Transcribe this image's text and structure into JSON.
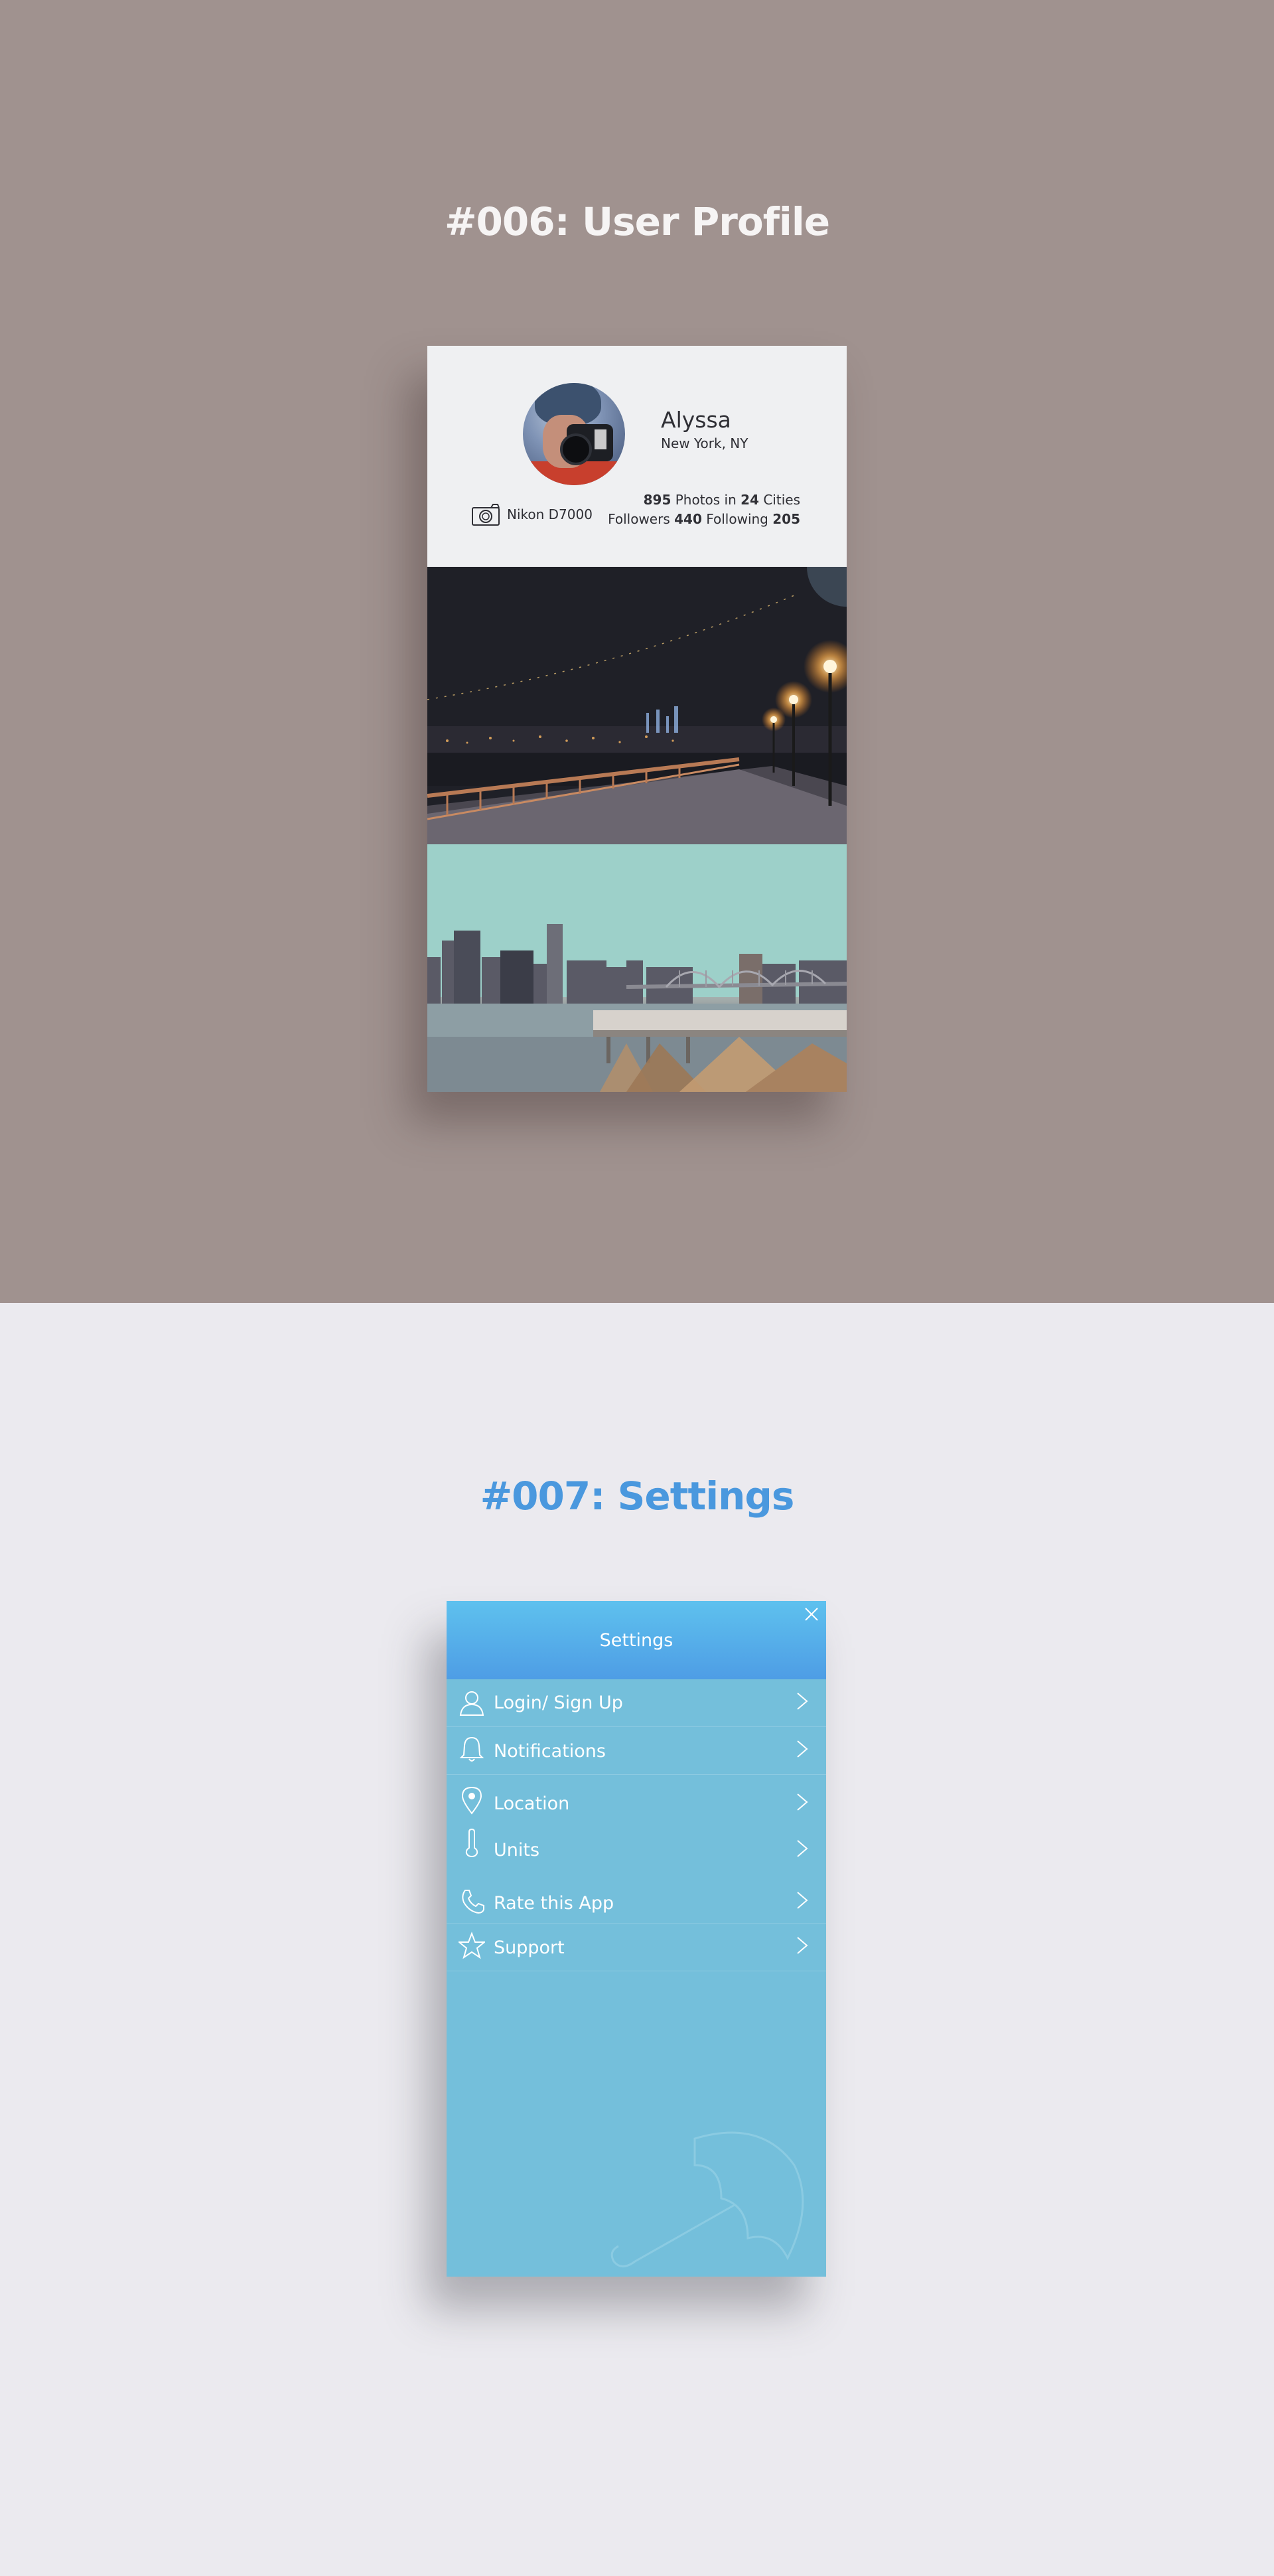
{
  "profile_section": {
    "heading": "#006: User Profile",
    "user": {
      "name": "Alyssa",
      "location": "New York, NY"
    },
    "camera": {
      "icon": "camera-icon",
      "model": "Nikon D7000"
    },
    "stats": {
      "photos_count": "895",
      "photos_label": "Photos in",
      "cities_count": "24",
      "cities_label": "Cities",
      "followers_label": "Followers",
      "followers_count": "440",
      "following_label": "Following",
      "following_count": "205"
    }
  },
  "settings_section": {
    "heading": "#007: Settings",
    "title": "Settings",
    "close_icon": "close-icon",
    "items": [
      {
        "label": "Login/ Sign Up",
        "icon": "user-icon"
      },
      {
        "label": "Notifications",
        "icon": "bell-icon"
      },
      {
        "label": "Location",
        "icon": "location-pin-icon"
      },
      {
        "label": "Units",
        "icon": "thermometer-icon"
      },
      {
        "label": "Rate this App",
        "icon": "phone-icon"
      },
      {
        "label": "Support",
        "icon": "star-icon"
      }
    ]
  },
  "colors": {
    "top_background": "#a0928f",
    "bottom_background": "#ebeaef",
    "settings_heading": "#4a98de",
    "settings_header_top": "#5ec1ee",
    "settings_header_bottom": "#4e9de5",
    "settings_body": "#74bfdb"
  }
}
